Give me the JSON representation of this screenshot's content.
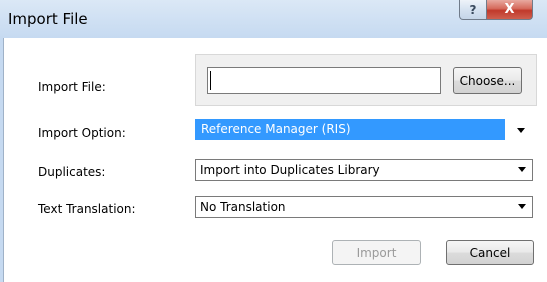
{
  "window": {
    "title": "Import File",
    "help_button": "?",
    "close_button": "X"
  },
  "import_file": {
    "label": "Import File:",
    "value": "",
    "choose_label": "Choose..."
  },
  "import_option": {
    "label": "Import Option:",
    "selected": "Reference Manager (RIS)"
  },
  "duplicates": {
    "label": "Duplicates:",
    "selected": "Import into Duplicates Library"
  },
  "text_translation": {
    "label": "Text Translation:",
    "selected": "No Translation"
  },
  "footer": {
    "import_label": "Import",
    "cancel_label": "Cancel"
  },
  "colors": {
    "selection": "#3399ff",
    "close_button": "#c0392b",
    "titlebar": "#cfe0f3"
  }
}
